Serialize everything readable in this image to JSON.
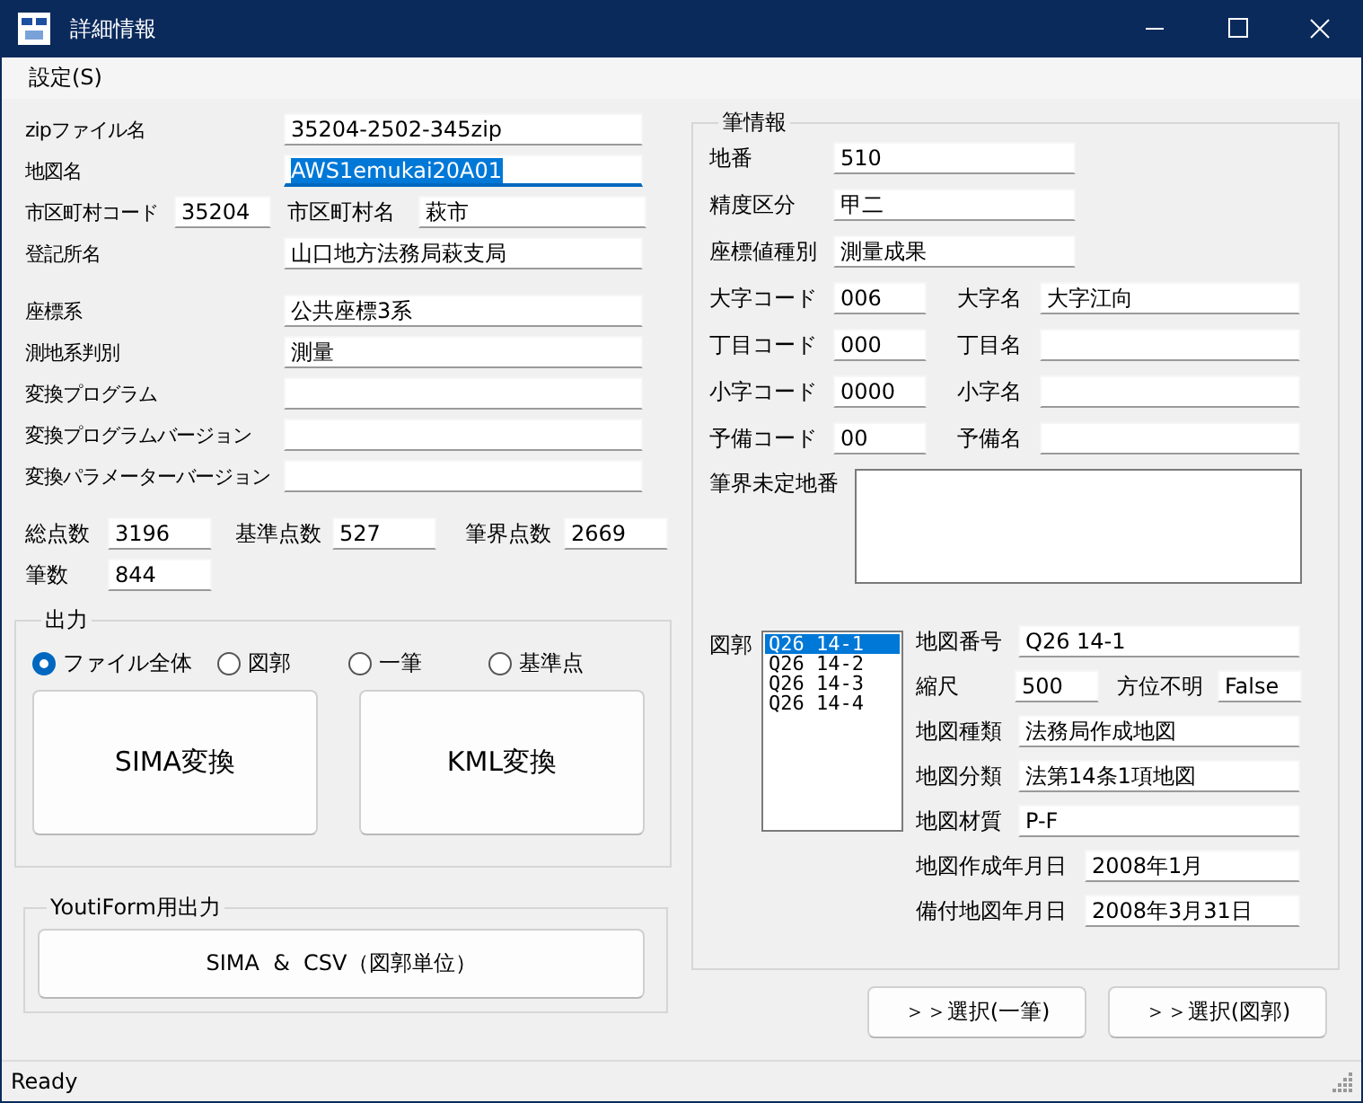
{
  "window": {
    "title": "詳細情報"
  },
  "menu": [
    {
      "label": "設定(S)"
    }
  ],
  "left_sections": [
    {
      "rows": [
        {
          "kind": "wide",
          "label": "zipファイル名",
          "value": "35204-2502-345zip",
          "focused": false
        },
        {
          "kind": "wide",
          "label": "地図名",
          "value": "AWS1emukai20A01",
          "focused": true
        },
        {
          "kind": "pair",
          "label": "市区町村コード",
          "value": "35204",
          "label2": "市区町村名",
          "value2": "萩市"
        },
        {
          "kind": "wide",
          "label": "登記所名",
          "value": "山口地方法務局萩支局",
          "focused": false
        }
      ]
    },
    {
      "rows": [
        {
          "kind": "wide",
          "label": "座標系",
          "value": "公共座標3系",
          "focused": false
        },
        {
          "kind": "wide",
          "label": "測地系判別",
          "value": "測量",
          "focused": false
        },
        {
          "kind": "wide",
          "label": "変換プログラム",
          "focused": false
        },
        {
          "kind": "wide",
          "label": "変換プログラムバージョン",
          "focused": false
        },
        {
          "kind": "wide",
          "label": "変換パラメーターバージョン",
          "focused": false
        }
      ]
    },
    {
      "rows": [
        {
          "kind": "counts",
          "items": [
            {
              "label": "総点数",
              "value": "3196"
            },
            {
              "label": "基準点数",
              "value": "527"
            },
            {
              "label": "筆界点数",
              "value": "2669"
            }
          ]
        },
        {
          "kind": "counts",
          "items": [
            {
              "label": "筆数",
              "value": "844"
            }
          ]
        }
      ]
    }
  ],
  "output": {
    "title": "出力",
    "options": [
      {
        "label": "ファイル全体",
        "selected": true
      },
      {
        "label": "図郭",
        "selected": false
      },
      {
        "label": "一筆",
        "selected": false
      },
      {
        "label": "基準点",
        "selected": false
      }
    ],
    "buttons": [
      "SIMA変換",
      "KML変換"
    ]
  },
  "youtiform": {
    "title": "YoutiForm用出力",
    "button": "SIMA  &  CSV（図郭単位）"
  },
  "parcel": {
    "title": "筆情報",
    "rows": [
      {
        "kind": "wide",
        "label": "地番",
        "value": "510"
      },
      {
        "kind": "wide",
        "label": "精度区分",
        "value": "甲二"
      },
      {
        "kind": "wide",
        "label": "座標値種別",
        "value": "測量成果"
      },
      {
        "kind": "pair",
        "label": "大字コード",
        "value": "006",
        "label2": "大字名",
        "value2": "大字江向"
      },
      {
        "kind": "pair",
        "label": "丁目コード",
        "value": "000",
        "label2": "丁目名"
      },
      {
        "kind": "pair",
        "label": "小字コード",
        "value": "0000",
        "label2": "小字名"
      },
      {
        "kind": "pair",
        "label": "予備コード",
        "value": "00",
        "label2": "予備名"
      }
    ],
    "undetermined": {
      "label": "筆界未定地番"
    },
    "sheets": {
      "label": "図郭",
      "items": [
        {
          "text": "Q26 14-1",
          "selected": true
        },
        {
          "text": "Q26 14-2",
          "selected": false
        },
        {
          "text": "Q26 14-3",
          "selected": false
        },
        {
          "text": "Q26 14-4",
          "selected": false
        }
      ]
    },
    "sheet_rows": [
      {
        "kind": "wide",
        "label": "地図番号",
        "value": "Q26 14-1"
      },
      {
        "kind": "scale",
        "label": "縮尺",
        "value": "500",
        "label2": "方位不明",
        "value2": "False"
      },
      {
        "kind": "wide",
        "label": "地図種類",
        "value": "法務局作成地図"
      },
      {
        "kind": "wide",
        "label": "地図分類",
        "value": "法第14条1項地図"
      },
      {
        "kind": "wide",
        "label": "地図材質",
        "value": "P-F"
      },
      {
        "kind": "date",
        "label": "地図作成年月日",
        "value": "2008年1月"
      },
      {
        "kind": "date",
        "label": "備付地図年月日",
        "value": "2008年3月31日"
      }
    ]
  },
  "bottom_buttons": [
    "＞＞選択(一筆)",
    "＞＞選択(図郭)"
  ],
  "status_bar": {
    "text": "Ready"
  }
}
